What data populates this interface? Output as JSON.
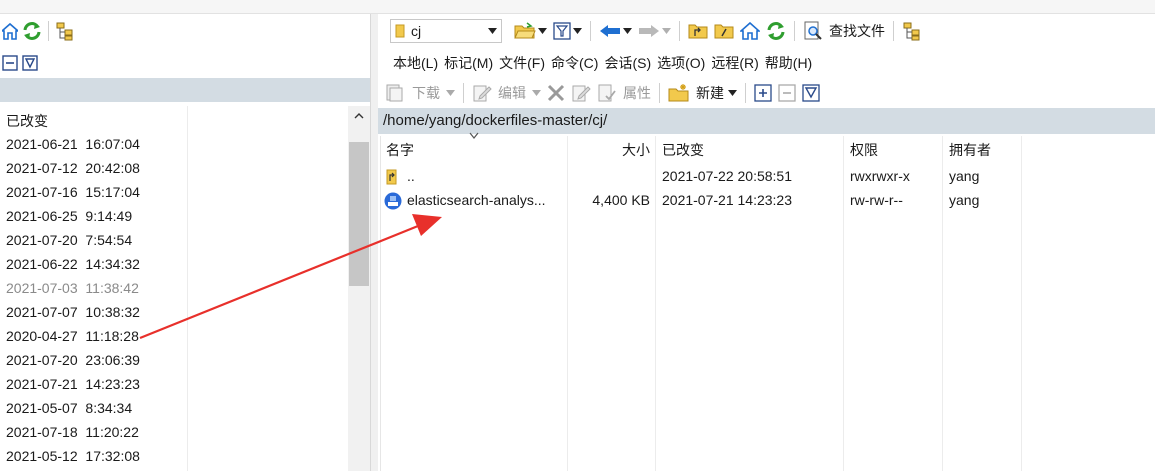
{
  "left_pane": {
    "column_header": "已改变",
    "rows": [
      {
        "date": "2021-06-21",
        "time": "16:07:04",
        "dim": false
      },
      {
        "date": "2021-07-12",
        "time": "20:42:08",
        "dim": false
      },
      {
        "date": "2021-07-16",
        "time": "15:17:04",
        "dim": false
      },
      {
        "date": "2021-06-25",
        "time": "9:14:49",
        "dim": false
      },
      {
        "date": "2021-07-20",
        "time": "7:54:54",
        "dim": false
      },
      {
        "date": "2021-06-22",
        "time": "14:34:32",
        "dim": false
      },
      {
        "date": "2021-07-03",
        "time": "11:38:42",
        "dim": true
      },
      {
        "date": "2021-07-07",
        "time": "10:38:32",
        "dim": false
      },
      {
        "date": "2020-04-27",
        "time": "11:18:28",
        "dim": false
      },
      {
        "date": "2021-07-20",
        "time": "23:06:39",
        "dim": false
      },
      {
        "date": "2021-07-21",
        "time": "14:23:23",
        "dim": false
      },
      {
        "date": "2021-05-07",
        "time": "8:34:34",
        "dim": false
      },
      {
        "date": "2021-07-18",
        "time": "11:20:22",
        "dim": false
      },
      {
        "date": "2021-05-12",
        "time": "17:32:08",
        "dim": false
      }
    ]
  },
  "right_pane": {
    "location_combo": "cj",
    "find_files_label": "查找文件",
    "menu": [
      "本地(L)",
      "标记(M)",
      "文件(F)",
      "命令(C)",
      "会话(S)",
      "选项(O)",
      "远程(R)",
      "帮助(H)"
    ],
    "actions": {
      "download": "下载",
      "edit": "编辑",
      "properties": "属性",
      "new": "新建"
    },
    "path": "/home/yang/dockerfiles-master/cj/",
    "columns": {
      "name": "名字",
      "size": "大小",
      "changed": "已改变",
      "rights": "权限",
      "owner": "拥有者"
    },
    "files": [
      {
        "name": "..",
        "size": "",
        "changed": "2021-07-22 20:58:51",
        "rights": "rwxrwxr-x",
        "owner": "yang",
        "icon": "parent-folder-icon"
      },
      {
        "name": "elasticsearch-analys...",
        "size": "4,400 KB",
        "changed": "2021-07-21 14:23:23",
        "rights": "rw-rw-r--",
        "owner": "yang",
        "icon": "zip-file-icon"
      }
    ]
  },
  "colors": {
    "path_bar_bg": "#d3dce3",
    "annotation_arrow": "#e8302b",
    "refresh_green": "#2f9e2f",
    "nav_blue": "#1f6fd1"
  }
}
